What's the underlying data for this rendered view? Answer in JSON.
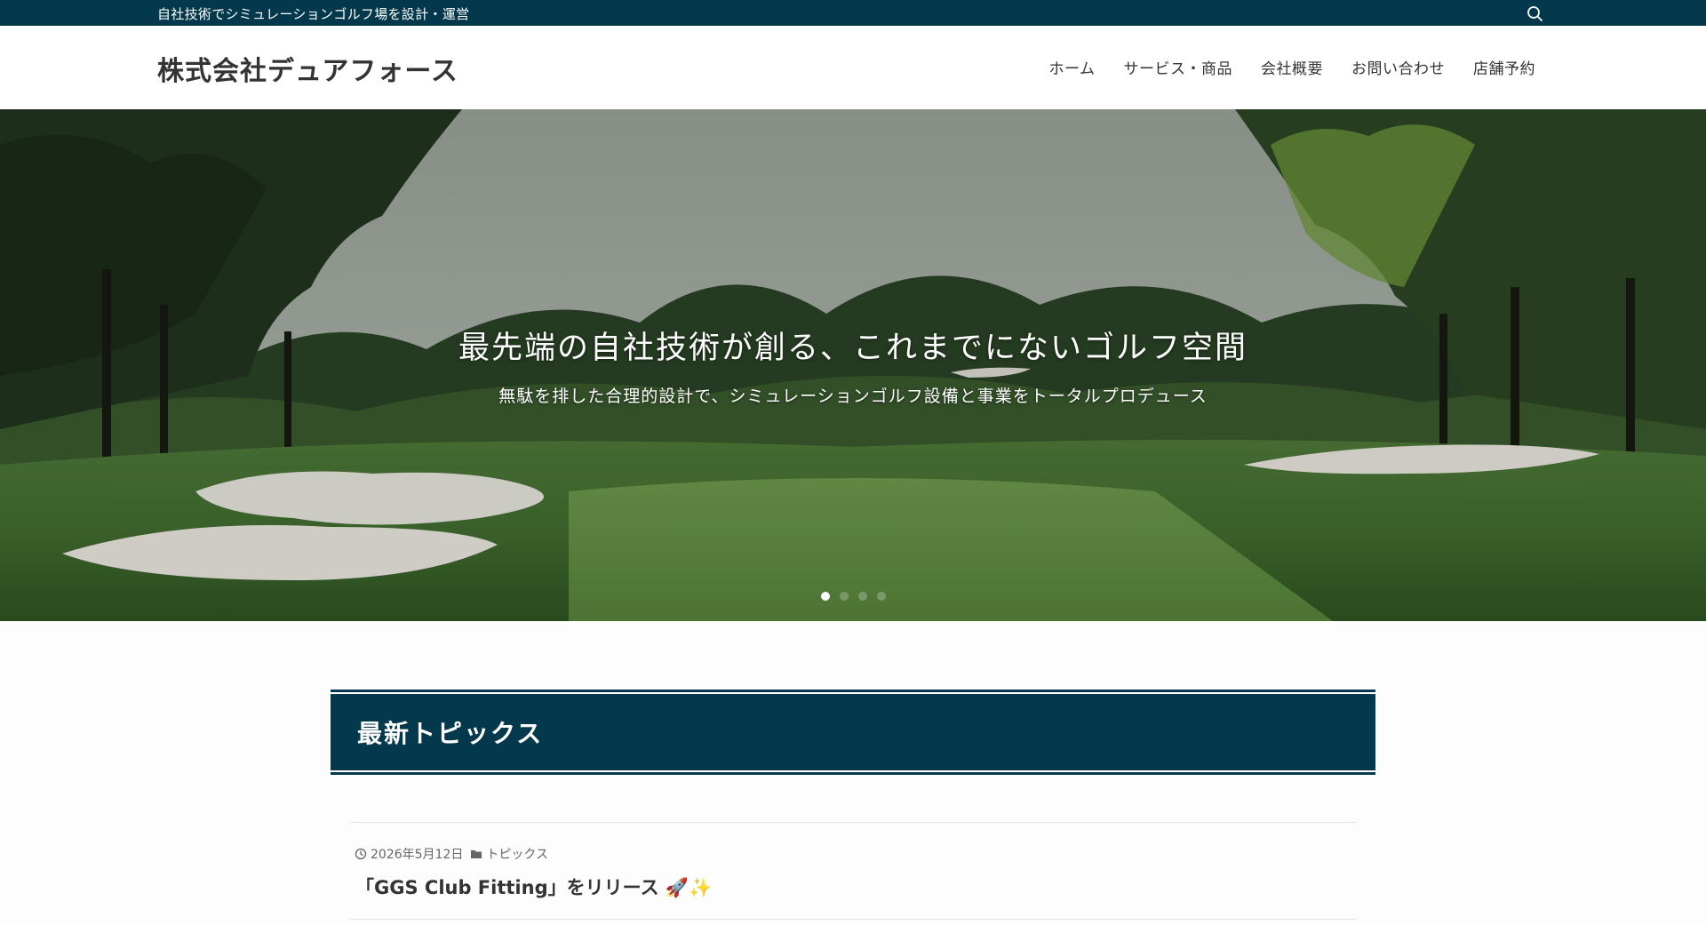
{
  "topbar": {
    "tagline": "自社技術でシミュレーションゴルフ場を設計・運営",
    "search_icon": "search-icon"
  },
  "header": {
    "logo": "株式会社デュアフォース",
    "nav": [
      {
        "label": "ホーム"
      },
      {
        "label": "サービス・商品"
      },
      {
        "label": "会社概要"
      },
      {
        "label": "お問い合わせ"
      },
      {
        "label": "店舗予約"
      }
    ]
  },
  "hero": {
    "title": "最先端の自社技術が創る、これまでにないゴルフ空間",
    "subtitle": "無駄を排した合理的設計で、シミュレーションゴルフ設備と事業をトータルプロデュース",
    "slides_total": 4,
    "active_slide": 1
  },
  "topics": {
    "heading": "最新トピックス",
    "posts": [
      {
        "date": "2026年5月12日",
        "category": "トピックス",
        "title": "「GGS Club Fitting」をリリース 🚀✨"
      }
    ]
  },
  "colors": {
    "brand": "#04384c",
    "text": "#333333",
    "white": "#ffffff"
  }
}
